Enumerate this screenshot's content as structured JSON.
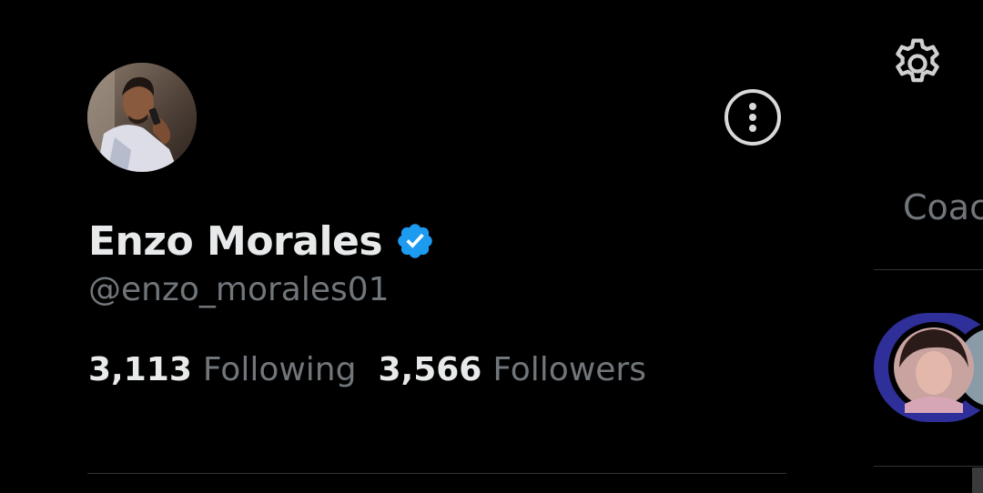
{
  "profile": {
    "name": "Enzo Morales",
    "handle": "@enzo_morales01",
    "verified": true,
    "avatar_icon": "user-avatar-photo"
  },
  "stats": {
    "following_count": "3,113",
    "following_label": "Following",
    "followers_count": "3,566",
    "followers_label": "Followers"
  },
  "actions": {
    "more_icon": "more-options-icon"
  },
  "background_app": {
    "settings_icon": "gear-icon",
    "tab_partial": "Coac"
  },
  "colors": {
    "background": "#000000",
    "primary_text": "#e7e9ea",
    "secondary_text": "#71767b",
    "verified_blue": "#1d9bf0",
    "story_ring": "#3b3ba8",
    "divider": "#2f3336"
  }
}
